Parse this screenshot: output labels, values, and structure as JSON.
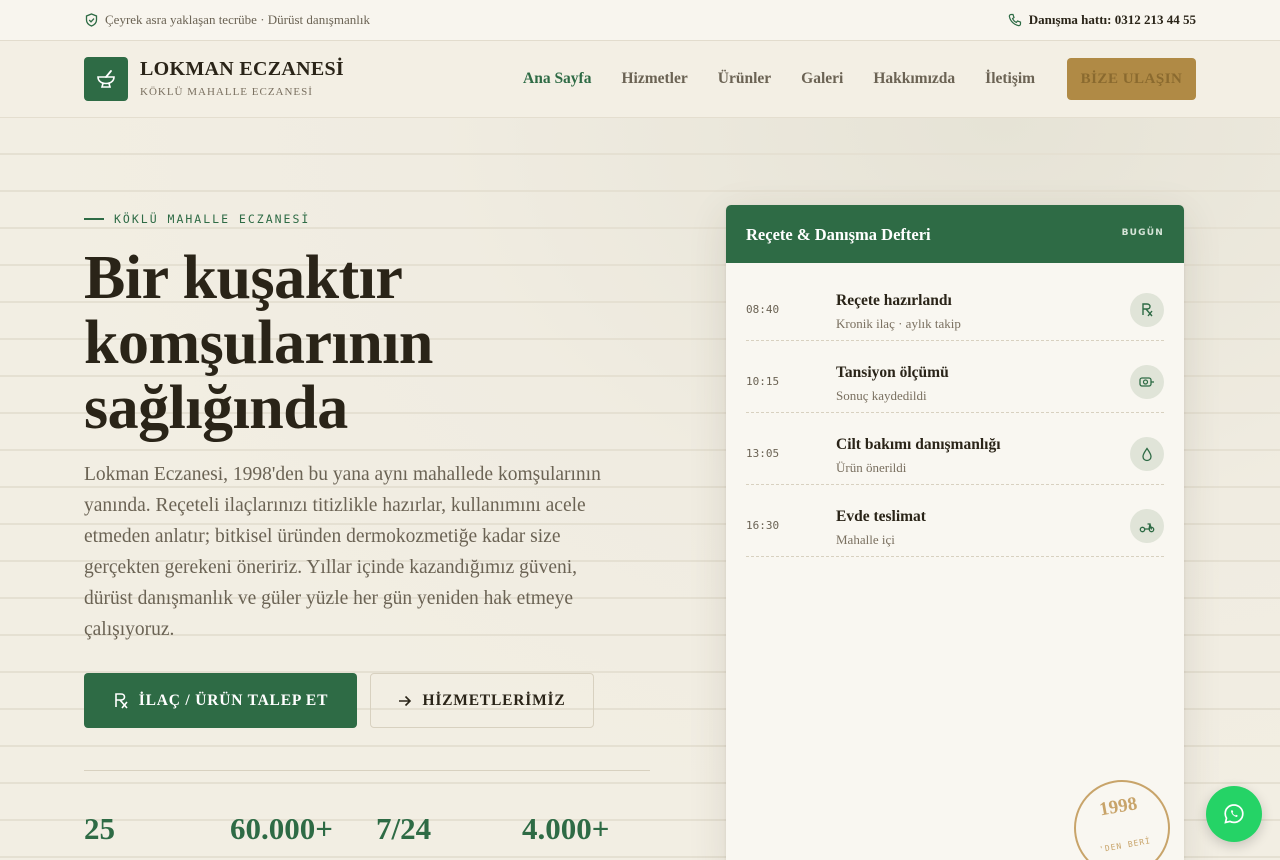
{
  "topbar": {
    "tagline": "Çeyrek asra yaklaşan tecrübe · Dürüst danışmanlık",
    "tagline_icon": "shield-check-icon",
    "hotline": "Danışma hattı: 0312 213 44 55",
    "hotline_icon": "phone-icon"
  },
  "header": {
    "logo_icon": "mortar-pestle-icon",
    "brand_name": "LOKMAN ECZANESİ",
    "brand_sub": "KÖKLÜ MAHALLE ECZANESİ",
    "nav": [
      "Ana Sayfa",
      "Hizmetler",
      "Ürünler",
      "Galeri",
      "Hakkımızda",
      "İletişim"
    ],
    "active_nav": "Ana Sayfa",
    "cta": "BİZE ULAŞIN"
  },
  "hero": {
    "eyebrow": "KÖKLÜ MAHALLE ECZANESİ",
    "headline_lines": [
      "Bir kuşaktır",
      "komşularının",
      "sağlığında"
    ],
    "lead": "Lokman Eczanesi, 1998'den bu yana aynı mahallede komşularının yanında. Reçeteli ilaçlarınızı titizlikle hazırlar, kullanımını acele etmeden anlatır; bitkisel üründen dermokozmetiğe kadar size gerçekten gerekeni öneririz. Yıllar içinde kazandığımız güveni, dürüst danışmanlık ve güler yüzle her gün yeniden hak etmeye çalışıyoruz.",
    "primary_button": "İLAÇ / ÜRÜN TALEP ET",
    "primary_icon": "rx-icon",
    "secondary_button": "HİZMETLERİMİZ",
    "secondary_icon": "arrow-right-icon",
    "stats": [
      "25",
      "60.000+",
      "7/24",
      "4.000+"
    ]
  },
  "card": {
    "title": "Reçete & Danışma Defteri",
    "badge": "BUGÜN",
    "entries": [
      {
        "time": "08:40",
        "title": "Reçete hazırlandı",
        "sub": "Kronik ilaç · aylık takip",
        "icon": "rx-icon"
      },
      {
        "time": "10:15",
        "title": "Tansiyon ölçümü",
        "sub": "Sonuç kaydedildi",
        "icon": "blood-pressure-icon"
      },
      {
        "time": "13:05",
        "title": "Cilt bakımı danışmanlığı",
        "sub": "Ürün önerildi",
        "icon": "droplet-icon"
      },
      {
        "time": "16:30",
        "title": "Evde teslimat",
        "sub": "Mahalle içi",
        "icon": "scooter-icon"
      }
    ]
  },
  "stamp": {
    "year": "1998",
    "since": "'DEN BERİ"
  },
  "whatsapp_icon": "whatsapp-icon",
  "colors": {
    "brand_green": "#2e6b45",
    "gold": "#b08a45",
    "background": "#f2eee3",
    "whatsapp": "#25d366"
  }
}
